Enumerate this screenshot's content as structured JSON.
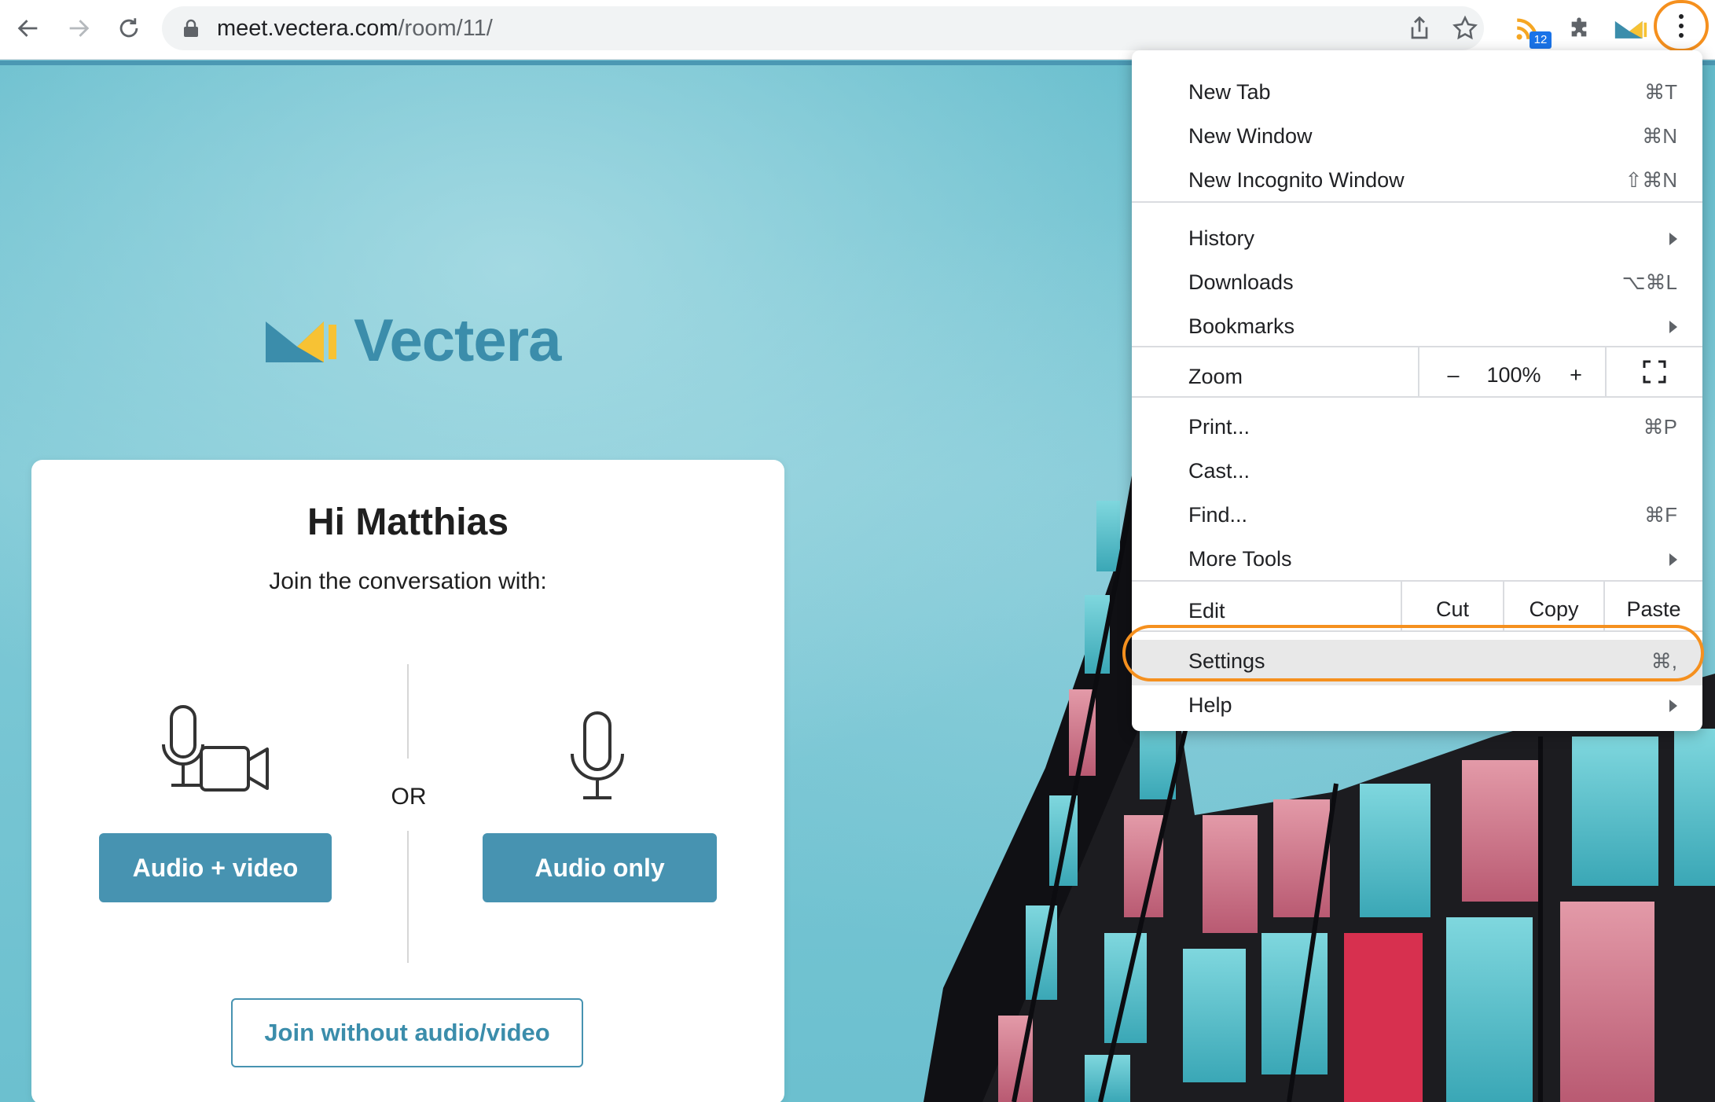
{
  "browser": {
    "url_host": "meet.vectera.com",
    "url_path": "/room/11/",
    "extension_badge": "12"
  },
  "colors": {
    "accent": "#4793b1",
    "highlight": "#f5901e"
  },
  "logo": {
    "text": "Vectera"
  },
  "card": {
    "greeting": "Hi Matthias",
    "subtitle": "Join the conversation with:",
    "or_label": "OR",
    "audio_video_button": "Audio + video",
    "audio_only_button": "Audio only",
    "join_without_button": "Join without audio/video"
  },
  "menu": {
    "new_tab": {
      "label": "New Tab",
      "shortcut": "⌘T"
    },
    "new_window": {
      "label": "New Window",
      "shortcut": "⌘N"
    },
    "new_incognito": {
      "label": "New Incognito Window",
      "shortcut": "⇧⌘N"
    },
    "history": {
      "label": "History"
    },
    "downloads": {
      "label": "Downloads",
      "shortcut": "⌥⌘L"
    },
    "bookmarks": {
      "label": "Bookmarks"
    },
    "zoom": {
      "label": "Zoom",
      "minus": "–",
      "value": "100%",
      "plus": "+"
    },
    "print": {
      "label": "Print...",
      "shortcut": "⌘P"
    },
    "cast": {
      "label": "Cast..."
    },
    "find": {
      "label": "Find...",
      "shortcut": "⌘F"
    },
    "more_tools": {
      "label": "More Tools"
    },
    "edit": {
      "label": "Edit",
      "cut": "Cut",
      "copy": "Copy",
      "paste": "Paste"
    },
    "settings": {
      "label": "Settings",
      "shortcut": "⌘,"
    },
    "help": {
      "label": "Help"
    }
  }
}
